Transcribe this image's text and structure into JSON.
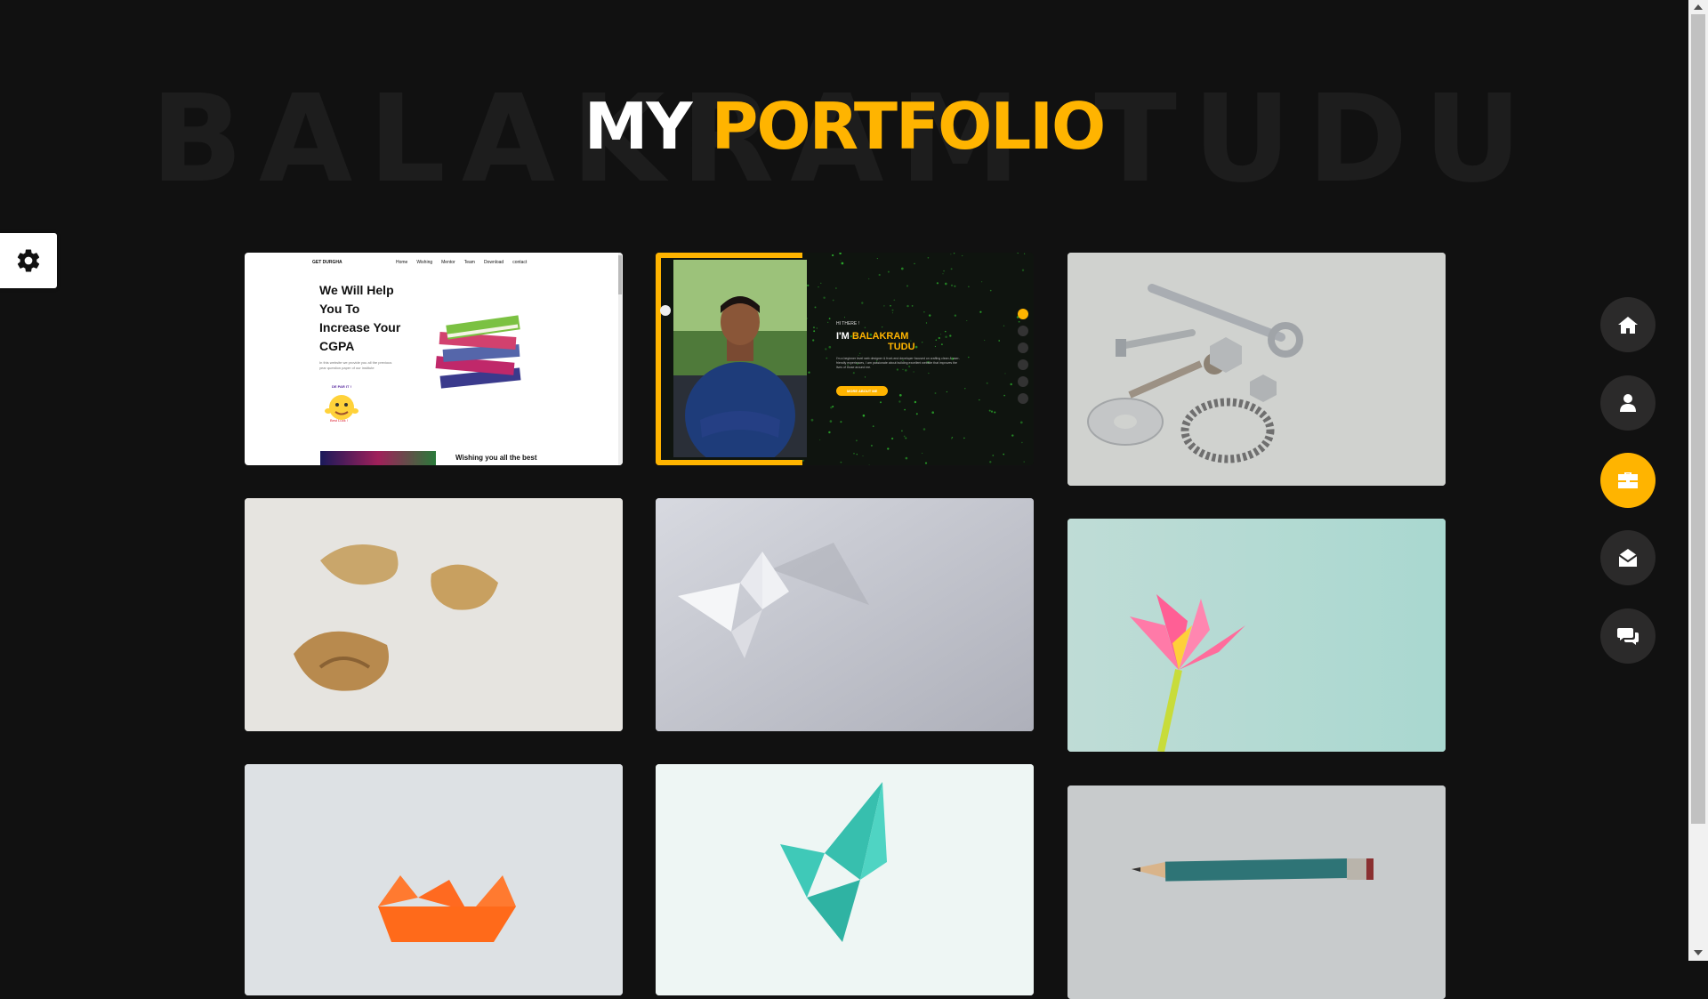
{
  "header": {
    "background_title": "BALAKRAM TUDU",
    "title_white": "MY",
    "title_yellow": "PORTFOLIO"
  },
  "colors": {
    "accent": "#ffb400",
    "background": "#111111",
    "nav_button": "#2b2a2a"
  },
  "settings": {
    "icon": "gear-icon"
  },
  "nav": [
    {
      "icon": "home-icon",
      "active": false
    },
    {
      "icon": "user-icon",
      "active": false
    },
    {
      "icon": "briefcase-icon",
      "active": true
    },
    {
      "icon": "envelope-open-icon",
      "active": false
    },
    {
      "icon": "comments-icon",
      "active": false
    }
  ],
  "portfolio": {
    "project1": {
      "brand": "GET DURGHA",
      "nav_items": [
        "Home",
        "Wishing",
        "Mentor",
        "Team",
        "Download",
        "contact"
      ],
      "headline_1": "We Will Help",
      "headline_2": "You To",
      "headline_3": "Increase Your",
      "headline_4": "CGPA",
      "body": "In this website we provide you all the previous year question paper of our institute",
      "badge": "DE PAR IT !",
      "badge_sub": "Best Luck !",
      "footer_text": "Wishing you all the best"
    },
    "project2": {
      "greeting": "HI THERE !",
      "name_prefix": "I'M",
      "name_1": "BALAKRAM",
      "name_2": "TUDU",
      "body": "I'm a beginner level web designer & front-end developer focused on crafting clean & user-friendly experiences, I am passionate about building excellent website that improves the lives of those around me.",
      "button": "MORE ABOUT ME"
    },
    "images": [
      "tools-photo",
      "fortune-cookies-photo",
      "paper-butterfly-photo",
      "paper-lily-photo",
      "paper-boat-photo",
      "teal-paper-butterfly-photo",
      "pencil-photo"
    ]
  }
}
